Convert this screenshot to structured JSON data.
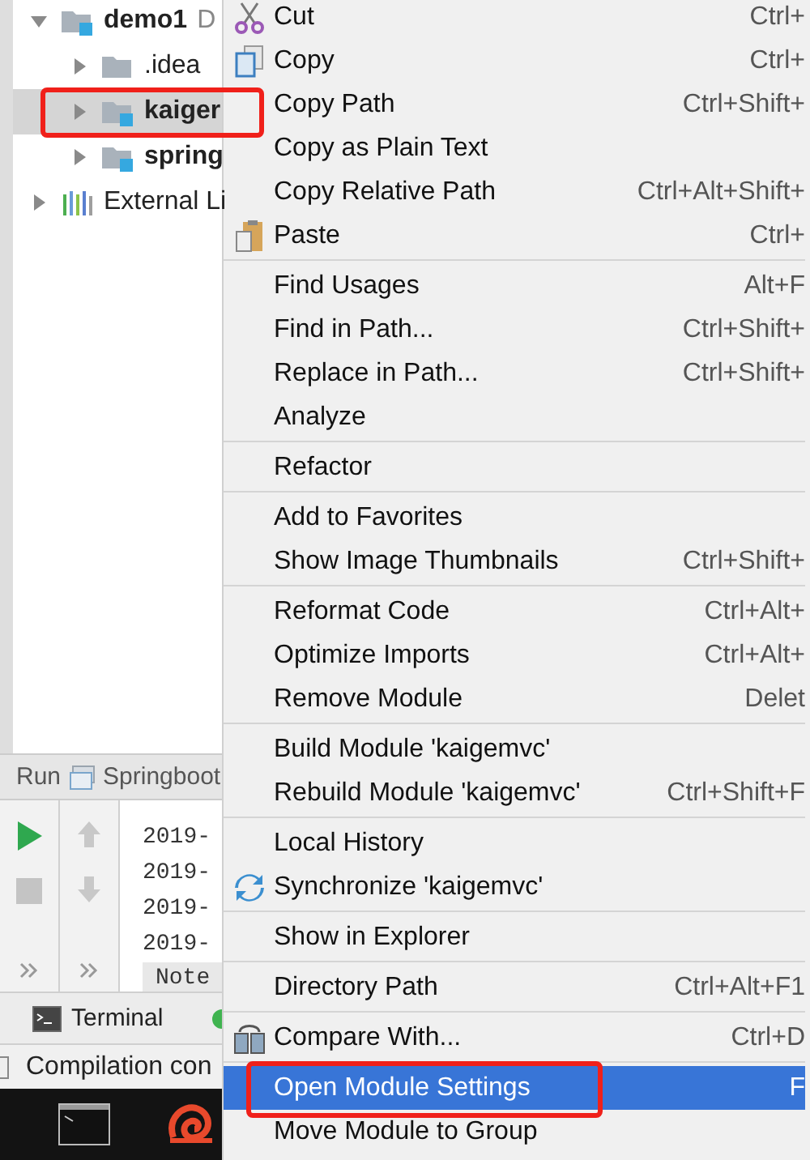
{
  "project_tree": [
    {
      "label": "demo1",
      "suffix": "D",
      "kind": "module",
      "expanded": true,
      "selected": false,
      "outlined": false,
      "children": [
        {
          "label": ".idea",
          "kind": "folder",
          "expanded": false,
          "selected": false,
          "outlined": false
        },
        {
          "label": "kaiger",
          "kind": "module",
          "expanded": false,
          "selected": true,
          "outlined": true
        },
        {
          "label": "spring",
          "kind": "module",
          "expanded": false,
          "selected": false,
          "outlined": false
        }
      ]
    },
    {
      "label": "External Li",
      "kind": "library",
      "expanded": false,
      "selected": false,
      "outlined": false
    }
  ],
  "run_panel": {
    "title": "Run",
    "config": "Springboot",
    "console_lines": [
      "2019-",
      "2019-",
      "2019-",
      "2019-"
    ],
    "note": "Note"
  },
  "terminal_tab": "Terminal",
  "status_bar": "Compilation con",
  "context_menu": [
    [
      {
        "label": "Cut",
        "shortcut": "Ctrl+",
        "selected": false,
        "outlined": false
      },
      {
        "label": "Copy",
        "shortcut": "Ctrl+",
        "selected": false,
        "outlined": false
      },
      {
        "label": "Copy Path",
        "shortcut": "Ctrl+Shift+",
        "selected": false,
        "outlined": false
      },
      {
        "label": "Copy as Plain Text",
        "selected": false,
        "outlined": false
      },
      {
        "label": "Copy Relative Path",
        "shortcut": "Ctrl+Alt+Shift+",
        "selected": false,
        "outlined": false
      },
      {
        "label": "Paste",
        "shortcut": "Ctrl+",
        "selected": false,
        "outlined": false
      }
    ],
    [
      {
        "label": "Find Usages",
        "shortcut": "Alt+F",
        "selected": false,
        "outlined": false
      },
      {
        "label": "Find in Path...",
        "shortcut": "Ctrl+Shift+",
        "selected": false,
        "outlined": false
      },
      {
        "label": "Replace in Path...",
        "shortcut": "Ctrl+Shift+",
        "selected": false,
        "outlined": false
      },
      {
        "label": "Analyze",
        "selected": false,
        "outlined": false
      }
    ],
    [
      {
        "label": "Refactor",
        "selected": false,
        "outlined": false
      }
    ],
    [
      {
        "label": "Add to Favorites",
        "selected": false,
        "outlined": false
      },
      {
        "label": "Show Image Thumbnails",
        "shortcut": "Ctrl+Shift+",
        "selected": false,
        "outlined": false
      }
    ],
    [
      {
        "label": "Reformat Code",
        "shortcut": "Ctrl+Alt+",
        "selected": false,
        "outlined": false
      },
      {
        "label": "Optimize Imports",
        "shortcut": "Ctrl+Alt+",
        "selected": false,
        "outlined": false
      },
      {
        "label": "Remove Module",
        "shortcut": "Delet",
        "selected": false,
        "outlined": false
      }
    ],
    [
      {
        "label": "Build Module 'kaigemvc'",
        "selected": false,
        "outlined": false
      },
      {
        "label": "Rebuild Module 'kaigemvc'",
        "shortcut": "Ctrl+Shift+F",
        "selected": false,
        "outlined": false
      }
    ],
    [
      {
        "label": "Local History",
        "selected": false,
        "outlined": false
      },
      {
        "label": "Synchronize 'kaigemvc'",
        "selected": false,
        "outlined": false
      }
    ],
    [
      {
        "label": "Show in Explorer",
        "selected": false,
        "outlined": false
      }
    ],
    [
      {
        "label": "Directory Path",
        "shortcut": "Ctrl+Alt+F1",
        "selected": false,
        "outlined": false
      }
    ],
    [
      {
        "label": "Compare With...",
        "shortcut": "Ctrl+D",
        "selected": false,
        "outlined": false
      }
    ],
    [
      {
        "label": "Open Module Settings",
        "shortcut": "F",
        "selected": true,
        "outlined": true
      },
      {
        "label": "Move Module to Group",
        "selected": false,
        "outlined": false
      }
    ]
  ]
}
